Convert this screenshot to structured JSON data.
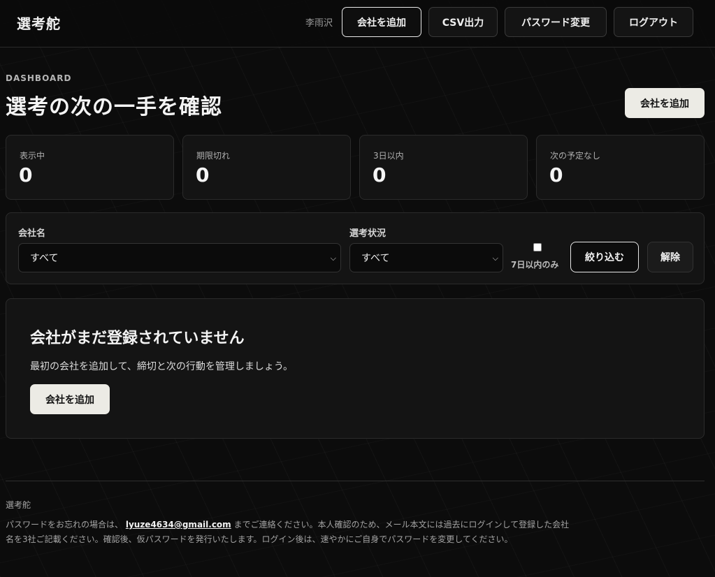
{
  "header": {
    "brand": "選考舵",
    "user": "李雨沢",
    "nav": {
      "add_company": "会社を追加",
      "csv_export": "CSV出力",
      "change_password": "パスワード変更",
      "logout": "ログアウト"
    }
  },
  "page": {
    "eyebrow": "DASHBOARD",
    "title": "選考の次の一手を確認",
    "add_company": "会社を追加"
  },
  "stats": [
    {
      "label": "表示中",
      "value": "0"
    },
    {
      "label": "期限切れ",
      "value": "0"
    },
    {
      "label": "3日以内",
      "value": "0"
    },
    {
      "label": "次の予定なし",
      "value": "0"
    }
  ],
  "filters": {
    "company_label": "会社名",
    "company_value": "すべて",
    "status_label": "選考状況",
    "status_value": "すべて",
    "within7_label": "7日以内のみ",
    "apply": "絞り込む",
    "clear": "解除"
  },
  "empty": {
    "title": "会社がまだ登録されていません",
    "description": "最初の会社を追加して、締切と次の行動を管理しましょう。",
    "cta": "会社を追加"
  },
  "footer": {
    "brand": "選考舵",
    "text_before": "パスワードをお忘れの場合は、",
    "email": "lyuze4634@gmail.com",
    "text_after": "までご連絡ください。本人確認のため、メール本文には過去にログインして登録した会社名を3社ご記載ください。確認後、仮パスワードを発行いたします。ログイン後は、速やかにご自身でパスワードを変更してください。"
  }
}
